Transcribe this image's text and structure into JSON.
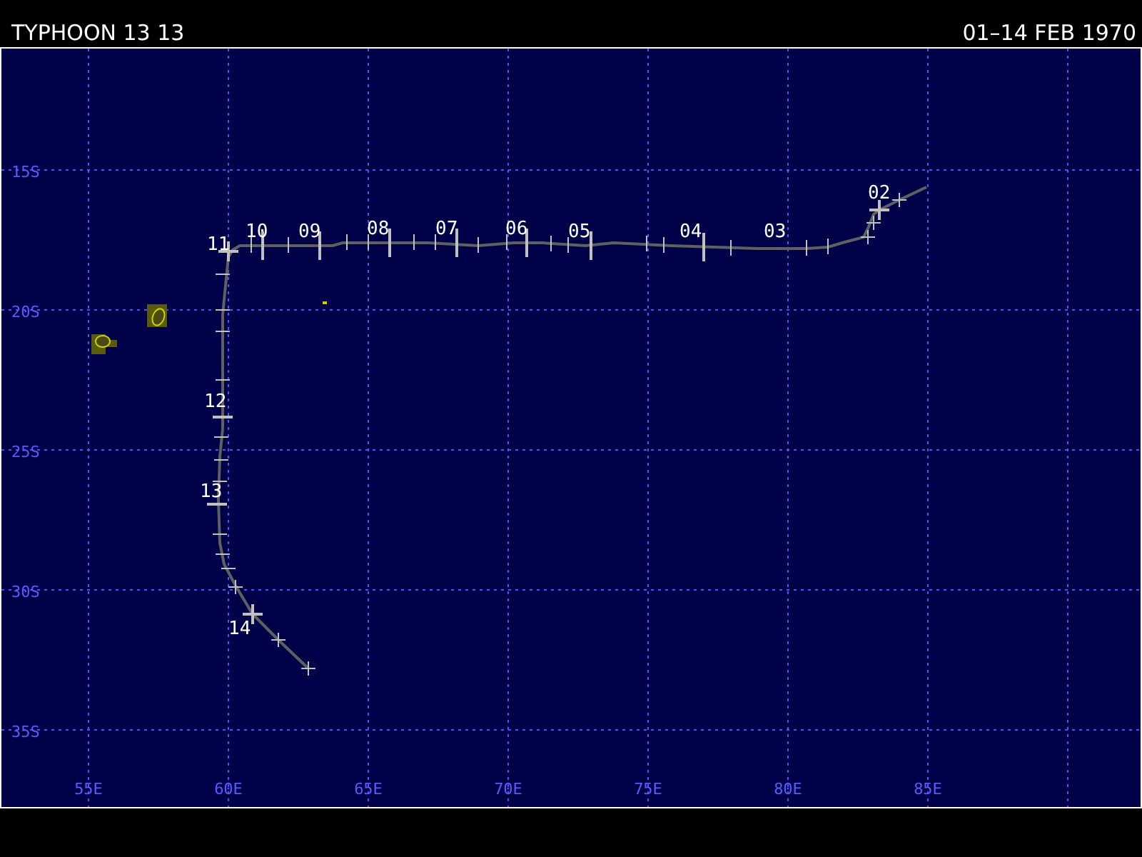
{
  "header": {
    "title": "TYPHOON 13 13",
    "dates": "01–14 FEB 1970"
  },
  "map": {
    "lat_labels": [
      "15S",
      "20S",
      "25S",
      "30S",
      "35S"
    ],
    "lon_labels": [
      "55E",
      "60E",
      "65E",
      "70E",
      "75E",
      "80E",
      "85E"
    ],
    "day_labels": [
      "11",
      "10",
      "09",
      "08",
      "07",
      "06",
      "05",
      "04",
      "03",
      "02",
      "12",
      "13",
      "14"
    ]
  }
}
